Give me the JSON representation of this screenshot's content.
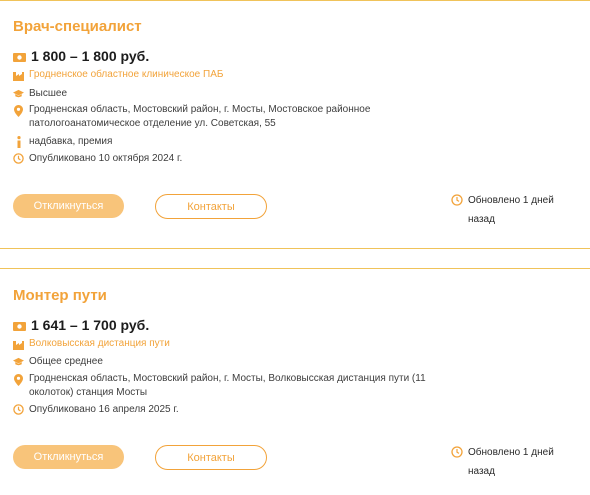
{
  "vacancies": [
    {
      "title": "Врач-специалист",
      "salary": "1 800 – 1 800 руб.",
      "employer": "Гродненское областное клиническое ПАБ",
      "education": "Высшее",
      "address": "Гродненская область, Мостовский район, г. Мосты, Мостовское районное патологоанатомическое отделение ул. Советская, 55",
      "extra": "надбавка, премия",
      "published": "Опубликовано 10 октября 2024 г.",
      "apply_label": "Откликнуться",
      "contacts_label": "Контакты",
      "updated": "Обновлено 1 дней назад"
    },
    {
      "title": "Монтер пути",
      "salary": "1 641 – 1 700 руб.",
      "employer": "Волковысская дистанция пути",
      "education": "Общее среднее",
      "address": "Гродненская область, Мостовский район, г. Мосты, Волковысская дистанция пути (11 околоток) станция Мосты",
      "published": "Опубликовано 16 апреля 2025 г.",
      "apply_label": "Откликнуться",
      "contacts_label": "Контакты",
      "updated": "Обновлено 1 дней назад"
    }
  ],
  "colors": {
    "accent": "#f2a33a",
    "button_fill": "#f8c47a",
    "divider": "#f0c35a"
  },
  "icons": [
    "money-icon",
    "building-icon",
    "graduation-cap-icon",
    "location-pin-icon",
    "info-icon",
    "clock-icon"
  ]
}
